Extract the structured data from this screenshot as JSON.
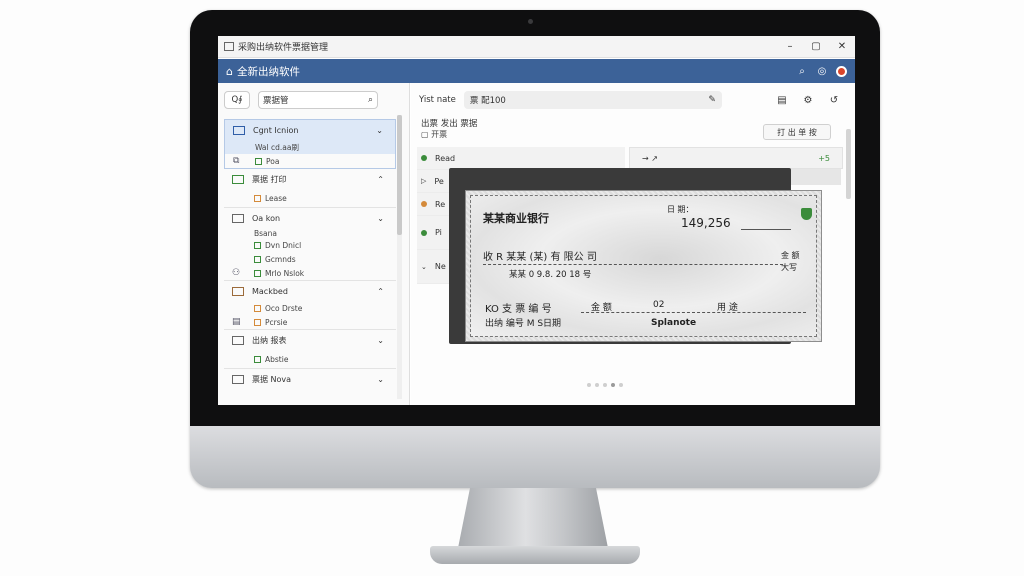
{
  "window": {
    "title": "采购出纳软件票据管理",
    "min_symbol": "–",
    "max_symbol": "▢",
    "close_symbol": "✕"
  },
  "appbar": {
    "home_icon": "home-icon",
    "title": "全新出纳软件",
    "icons": [
      "search-icon",
      "settings-icon",
      "record-icon"
    ]
  },
  "left_panel": {
    "filter_label": "Q∮",
    "search_value": "票据管",
    "groups": [
      {
        "label": "Cgnt Icnion",
        "sub_head": "Wal cd.aa刷",
        "items": [
          {
            "box": "green",
            "text": "Poa"
          }
        ]
      },
      {
        "label": "票据 打印",
        "items": [
          {
            "box": "org",
            "text": "Lease"
          }
        ]
      },
      {
        "label": "Oa kon",
        "sub_head": "Bsana",
        "items": [
          {
            "box": "green",
            "text": "Dvn Dnicl"
          },
          {
            "box": "green",
            "text": "Gcmnds"
          },
          {
            "box": "green",
            "text": "Mrlo Nslok"
          }
        ]
      },
      {
        "label": "Mackbed",
        "items": [
          {
            "box": "org",
            "text": "Oco Drste"
          },
          {
            "box": "org",
            "text": "Pcrsie"
          }
        ]
      },
      {
        "label": "出纳 报表",
        "items": [
          {
            "box": "green",
            "text": "Abstie"
          }
        ]
      },
      {
        "label": "票据 Nova",
        "items": []
      }
    ]
  },
  "main_panel": {
    "field_label": "Yist nate",
    "combo_value": "票 配100",
    "section_title": "出票 发出 票据",
    "section_sub": "开票",
    "action_button": "打 出 单 按",
    "rows": [
      {
        "marker": "dot-green",
        "text": "Read"
      },
      {
        "marker": "triangle",
        "text": "Pe"
      },
      {
        "marker": "dot-orange",
        "text": "Re"
      },
      {
        "marker": "dot-green",
        "text": "Pi"
      },
      {
        "marker": "chevron",
        "text": "Ne"
      }
    ],
    "right_header": {
      "left": "→ ↗",
      "right": "+5"
    }
  },
  "check": {
    "bank_name": "某某商业银行",
    "date_label": "日 期：",
    "amount": "149,256",
    "payee": "收 R 某某 (某) 有 限公 司",
    "payee_line2": "某某 0 9.8. 20 18 号",
    "right_label1": "金 额",
    "right_label2": "大写",
    "memo": "KO 支 票 编 号",
    "memo2": "金 额",
    "memo3": "02",
    "memo4": "用 途",
    "micr": "出纳 编号 M S日期",
    "signature": "Splanote"
  }
}
